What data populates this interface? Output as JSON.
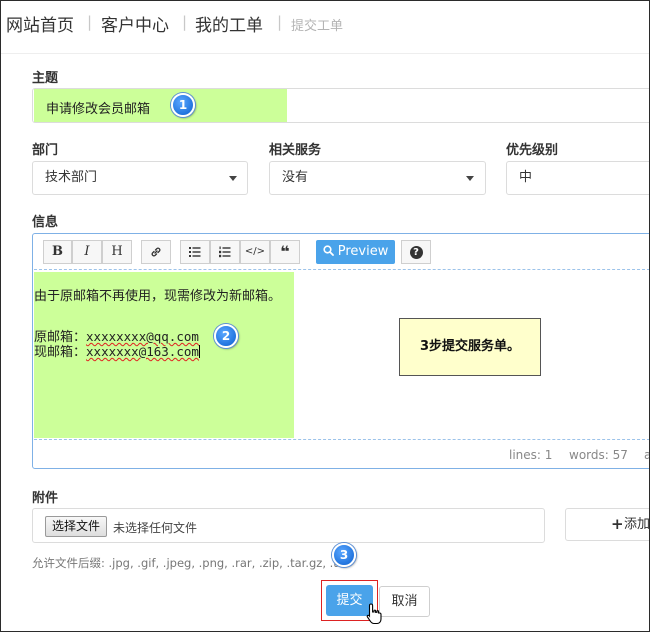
{
  "breadcrumb": {
    "items": [
      "网站首页",
      "客户中心",
      "我的工单"
    ],
    "separator": "|",
    "current": "提交工单"
  },
  "form": {
    "subject": {
      "label": "主题",
      "value": "申请修改会员邮箱"
    },
    "department": {
      "label": "部门",
      "value": "技术部门"
    },
    "service": {
      "label": "相关服务",
      "value": "没有"
    },
    "priority": {
      "label": "优先级别",
      "value": "中"
    },
    "message": {
      "label": "信息",
      "toolbar": {
        "bold": "B",
        "italic": "I",
        "heading": "H",
        "link_icon": "link-icon",
        "ul_icon": "unordered-list-icon",
        "ol_icon": "ordered-list-icon",
        "code": "</>",
        "quote_icon": "quote-icon",
        "preview": "Preview",
        "preview_icon": "search-icon",
        "help": "?"
      },
      "lines": [
        "由于原邮箱不再使用，现需修改为新邮箱。",
        "",
        "原邮箱：xxxxxxxx@qq.com",
        "现邮箱：xxxxxxx@163.com"
      ],
      "line3_label": "原邮箱：",
      "line3_email": "xxxxxxxx@qq.com",
      "line4_label": "现邮箱：",
      "line4_email": "xxxxxxx@163.com",
      "status": {
        "lines": "lines: 1",
        "words": "words: 57",
        "tail": "a"
      }
    },
    "attachment": {
      "label": "附件",
      "choose_button": "选择文件",
      "status": "未选择任何文件",
      "add_button": "添加",
      "hint": "允许文件后缀: .jpg, .gif, .jpeg, .png, .rar, .zip, .tar.gz, .t"
    },
    "submit_button": "提交",
    "cancel_button": "取消"
  },
  "annotations": {
    "callout": "3步提交服务单。",
    "steps": [
      "1",
      "2",
      "3"
    ]
  },
  "colors": {
    "highlight": "#ccff99",
    "primary": "#4aa3ea",
    "callout_bg": "#ffffcc",
    "badge": "#1a73e8"
  }
}
